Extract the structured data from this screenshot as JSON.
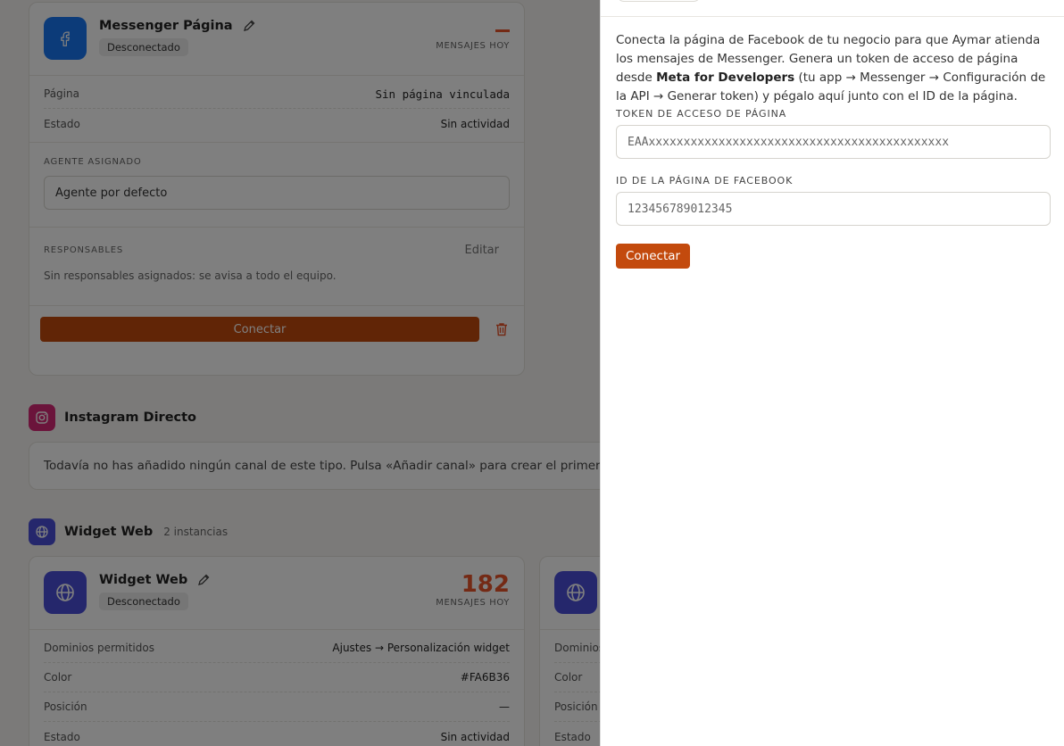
{
  "messenger_card": {
    "title": "Messenger Página",
    "status": "Desconectado",
    "stat_label": "Mensajes hoy",
    "rows": [
      {
        "label": "Página",
        "value": "Sin página vinculada"
      },
      {
        "label": "Estado",
        "value": "Sin actividad"
      }
    ],
    "agent_label": "Agente asignado",
    "agent_value": "Agente por defecto",
    "responsables_label": "Responsables",
    "edit_label": "Editar",
    "responsables_note": "Sin responsables asignados: se avisa a todo el equipo.",
    "connect_label": "Conectar"
  },
  "instagram_section": {
    "title": "Instagram Directo",
    "empty_text": "Todavía no has añadido ningún canal de este tipo. Pulsa «Añadir canal» para crear el primero."
  },
  "widget_section": {
    "title": "Widget Web",
    "count": "2 instancias"
  },
  "widget_card": {
    "title": "Widget Web",
    "status": "Desconectado",
    "stat_value": "182",
    "stat_label": "Mensajes hoy",
    "rows": [
      {
        "label": "Dominios permitidos",
        "value": "Ajustes → Personalización widget"
      },
      {
        "label": "Color",
        "value": "#FA6B36"
      },
      {
        "label": "Posición",
        "value": "—"
      },
      {
        "label": "Estado",
        "value": "Sin actividad"
      }
    ]
  },
  "widget_card_2": {
    "rows": [
      {
        "label": "Dominios"
      },
      {
        "label": "Color"
      },
      {
        "label": "Posición"
      },
      {
        "label": "Estado"
      }
    ]
  },
  "drawer": {
    "intro_1": "Conecta la página de Facebook de tu negocio para que Aymar atienda los mensajes de Messenger. Genera un token de acceso de página desde ",
    "intro_bold": "Meta for Developers",
    "intro_2": " (tu app → Messenger → Configuración de la API → Generar token) y pégalo aquí junto con el ID de la página.",
    "token_label": "Token de acceso de página",
    "token_placeholder": "EAAxxxxxxxxxxxxxxxxxxxxxxxxxxxxxxxxxxxxxxxxxxx",
    "page_id_label": "ID de la página de Facebook",
    "page_id_placeholder": "123456789012345",
    "connect_label": "Conectar"
  },
  "colors": {
    "accent": "#c34a0d",
    "stat_orange": "#e9542a",
    "facebook_blue": "#1877f2",
    "web_indigo": "#4a4fd8",
    "instagram_pink": "#d62976"
  }
}
